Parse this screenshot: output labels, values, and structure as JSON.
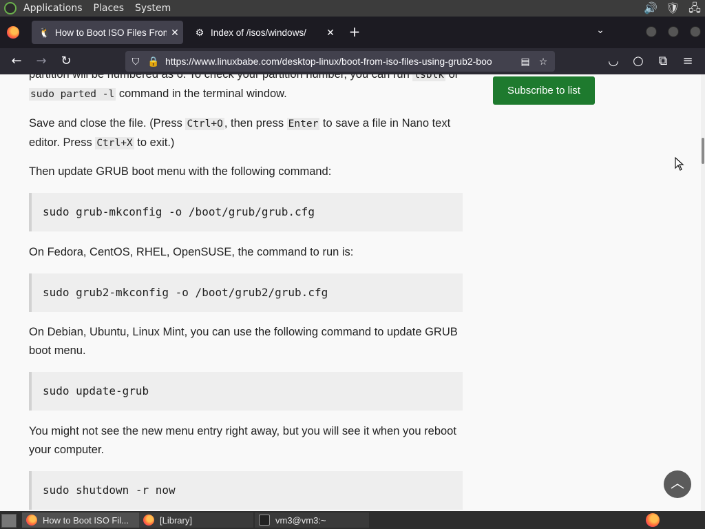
{
  "top_panel": {
    "menus": [
      "Applications",
      "Places",
      "System"
    ]
  },
  "tabs": [
    {
      "title": "How to Boot ISO Files From",
      "favicon": "tux-icon",
      "active": true
    },
    {
      "title": "Index of /isos/windows/",
      "favicon": "folder-icon",
      "active": false
    }
  ],
  "nav": {
    "url": "https://www.linuxbabe.com/desktop-linux/boot-from-iso-files-using-grub2-boo"
  },
  "article": {
    "partial_top_line_1": "partition will be numbered as 6. To check your partition number, you can run",
    "partial_top_code": "lsblk",
    "partial_top_or": "or",
    "partial_top_code2": "sudo parted -l",
    "partial_top_line_2_tail": "command in the terminal window.",
    "save_1": "Save and close the file. (Press",
    "save_code1": "Ctrl+O",
    "save_2": ", then press",
    "save_code2": "Enter",
    "save_3": "to save a file in Nano text editor. Press",
    "save_code3": "Ctrl+X",
    "save_4": "to exit.)",
    "update_intro": "Then update GRUB boot menu with the following command:",
    "cmd1": "sudo grub-mkconfig -o /boot/grub/grub.cfg",
    "fedora_intro": "On Fedora, CentOS, RHEL, OpenSUSE, the command to run is:",
    "cmd2": "sudo grub2-mkconfig -o /boot/grub2/grub.cfg",
    "debian_intro": "On Debian, Ubuntu, Linux Mint, you can use the following command to update GRUB boot menu.",
    "cmd3": "sudo update-grub",
    "reboot_intro": "You might not see the new menu entry right away, but you will see it when you reboot your computer.",
    "cmd4": "sudo shutdown -r now"
  },
  "sidebar": {
    "subscribe_label": "Subscribe to list"
  },
  "taskbar": {
    "items": [
      "How to Boot ISO Fil...",
      "[Library]",
      "vm3@vm3:~"
    ]
  },
  "colors": {
    "subscribe_bg": "#1e7a2e",
    "tab_active_bg": "#42414d",
    "navbar_bg": "#2b2a33"
  }
}
